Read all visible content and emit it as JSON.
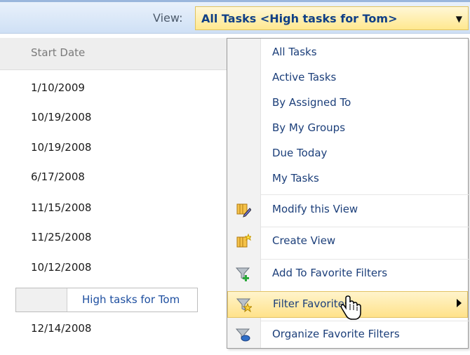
{
  "toolbar": {
    "view_label": "View:",
    "selected_view": "All Tasks <High tasks for Tom>"
  },
  "list": {
    "column_header": "Start Date",
    "dates": [
      "1/10/2009",
      "10/19/2008",
      "10/19/2008",
      "6/17/2008",
      "11/15/2008",
      "11/25/2008",
      "10/12/2008"
    ],
    "filter_row_label": "High tasks for Tom",
    "last_date": "12/14/2008"
  },
  "menu": {
    "views": [
      "All Tasks",
      "Active Tasks",
      "By Assigned To",
      "By My Groups",
      "Due Today",
      "My Tasks"
    ],
    "actions": [
      {
        "label": "Modify this View",
        "icon": "modify-view-icon"
      },
      {
        "label": "Create View",
        "icon": "create-view-icon"
      },
      {
        "label": "Add To Favorite Filters",
        "icon": "add-favorite-filter-icon"
      },
      {
        "label": "Filter Favorites",
        "icon": "filter-favorites-icon",
        "highlighted": true,
        "has_submenu": true
      },
      {
        "label": "Organize Favorite Filters",
        "icon": "organize-filters-icon"
      }
    ]
  },
  "colors": {
    "accent_text": "#1c3f7a",
    "highlight": "#ffe28a"
  }
}
